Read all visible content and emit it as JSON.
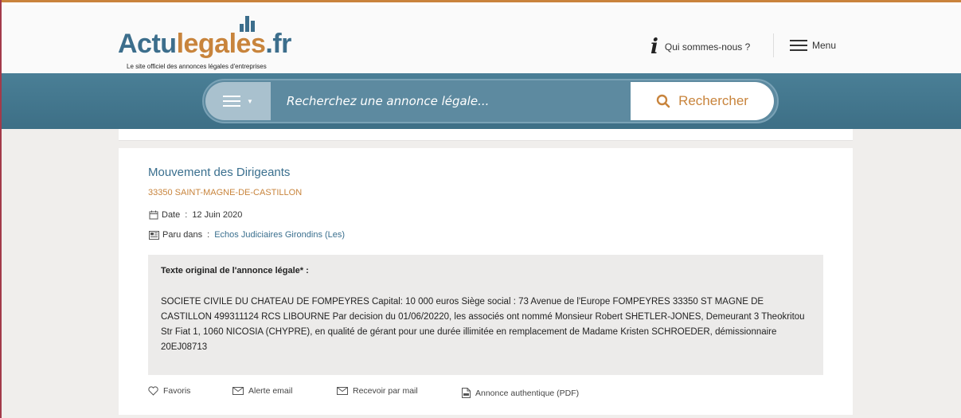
{
  "header": {
    "logo": {
      "part1": "Actu",
      "part2": "legales",
      "part3": ".fr",
      "tagline": "Le site officiel des annonces légales d'entreprises"
    },
    "about_label": "Qui sommes-nous ?",
    "menu_label": "Menu"
  },
  "search": {
    "placeholder": "Recherchez une annonce légale...",
    "button_label": "Rechercher"
  },
  "notice": {
    "title": "Mouvement des Dirigeants",
    "location": "33350 SAINT-MAGNE-DE-CASTILLON",
    "date_label": "Date",
    "date_value": "12 Juin 2020",
    "published_label": "Paru dans",
    "published_value": "Echos Judiciaires Girondins (Les)",
    "text_title": "Texte original de l'annonce légale* :",
    "text_body": "SOCIETE CIVILE DU CHATEAU DE FOMPEYRES Capital: 10 000 euros Siège social : 73 Avenue de l'Europe FOMPEYRES 33350 ST MAGNE DE CASTILLON 499311124 RCS LIBOURNE Par decision du 01/06/20220, les associés ont nommé Monsieur Robert SHETLER-JONES, Demeurant 3 Theokritou Str Fiat 1, 1060 NICOSIA (CHYPRE), en qualité de gérant pour une durée illimitée en remplacement de Madame Kristen SCHROEDER, démissionnaire 20EJ08713"
  },
  "actions": {
    "favorites": "Favoris",
    "email_alert": "Alerte email",
    "receive_mail": "Recevoir par mail",
    "pdf": "Annonce authentique (PDF)"
  },
  "colors": {
    "brand_blue": "#3c6e8c",
    "brand_orange": "#c8843c",
    "band_blue": "#4a7f96"
  }
}
